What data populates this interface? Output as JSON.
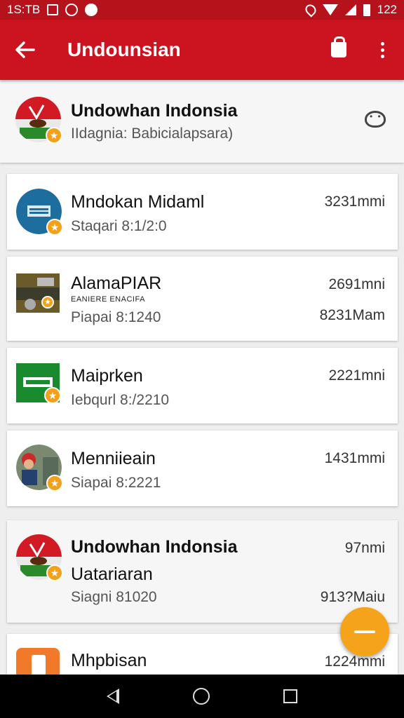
{
  "status_bar": {
    "time": "1S:TB",
    "battery_level": "122",
    "colors": {
      "background": "#b5121b"
    }
  },
  "app_bar": {
    "title": "Undounsian",
    "back_icon": "arrow-left-icon",
    "action_icons": [
      "shopping-bag-icon",
      "more-vert-icon"
    ],
    "color": "#cc1420"
  },
  "header": {
    "name": "Undowhan Indonsia",
    "subtitle": "IIdagnia: Babicialapsara)",
    "action_icon": "chat-icon"
  },
  "items": [
    {
      "name": "Mndokan Midaml",
      "extra": "",
      "subtitle": "Staqari 8:1/2:0",
      "distance": "3231mmi",
      "distance2": "",
      "avatar": "blue-circle"
    },
    {
      "name": "AlamaPIAR",
      "extra": "EANIERE ENACIFA",
      "subtitle": "Piapai 8:1240",
      "distance": "2691mni",
      "distance2": "8231Mam",
      "avatar": "photo-square"
    },
    {
      "name": "Maiprken",
      "extra": "",
      "subtitle": "Iebqurl 8:/2210",
      "distance": "2221mni",
      "distance2": "",
      "avatar": "green-square"
    },
    {
      "name": "Menniieain",
      "extra": "",
      "subtitle": "Siapai 8:2221",
      "distance": "1431mmi",
      "distance2": "",
      "avatar": "person-photo"
    },
    {
      "name": "Undowhan Indonsia",
      "extra": "Uatariaran",
      "subtitle": "Siagni 81020",
      "distance": "97nmi",
      "distance2": "913?Maiu",
      "avatar": "logo"
    },
    {
      "name": "Mhpbisan",
      "extra": "",
      "subtitle": "",
      "distance": "1224mmi",
      "distance2": "",
      "avatar": "orange"
    }
  ],
  "fab_icon": "minus-icon",
  "nav_bar_icons": [
    "nav-back-icon",
    "nav-home-icon",
    "nav-recents-icon"
  ]
}
